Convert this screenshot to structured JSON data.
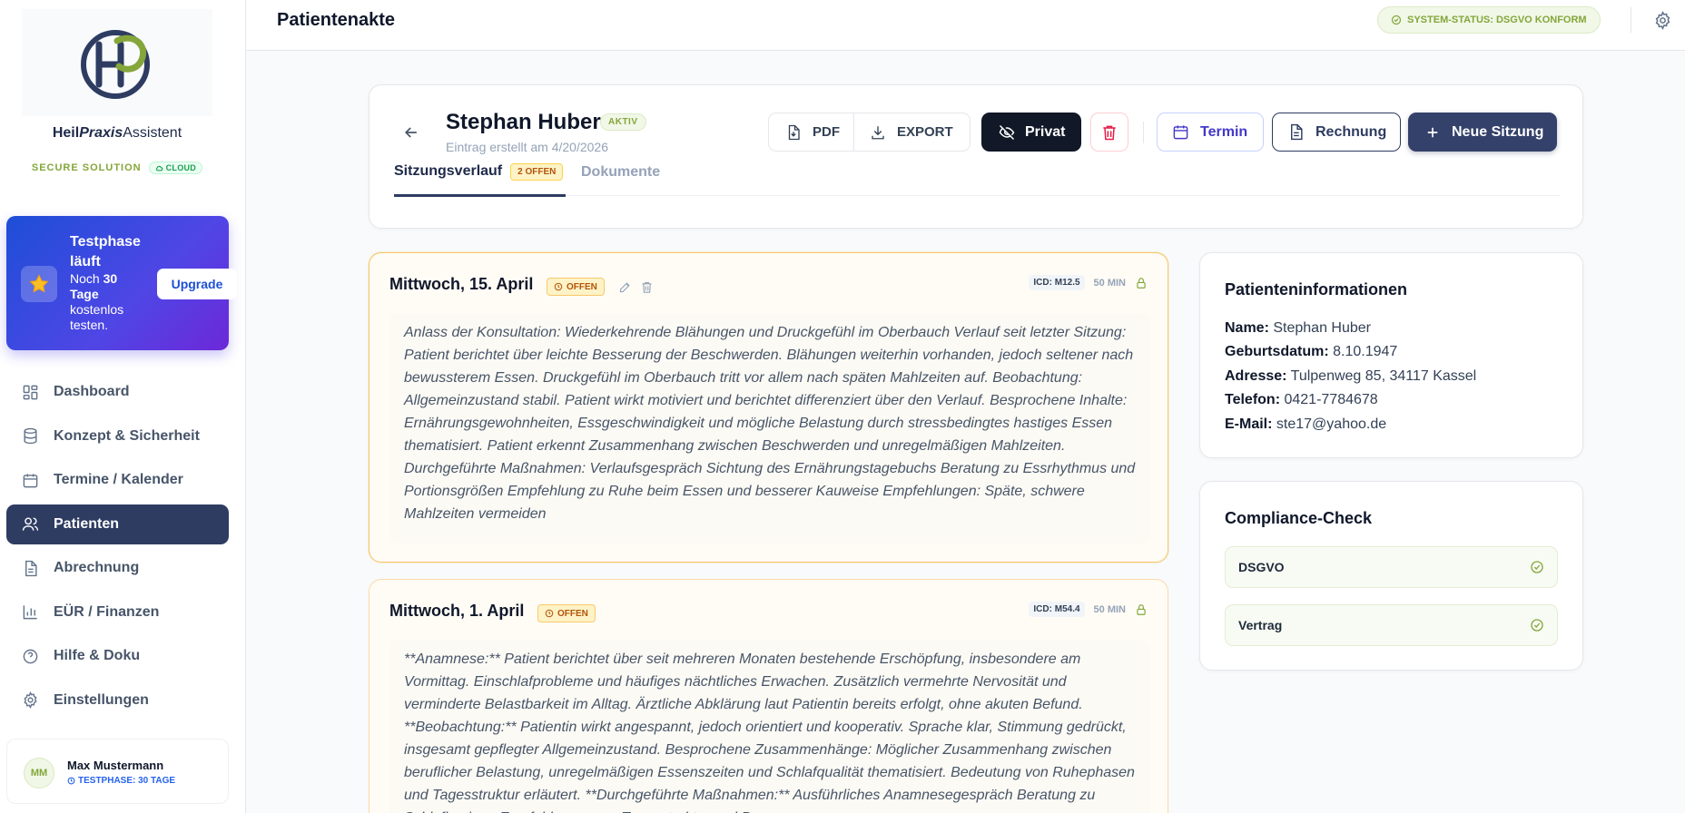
{
  "app": {
    "brand_prefix": "Heil",
    "brand_italic": "Praxis",
    "brand_suffix": "Assistent",
    "tagline": "SECURE SOLUTION",
    "cloud_badge": "CLOUD"
  },
  "trial": {
    "title": "Testphase läuft",
    "text_prefix": "Noch ",
    "days": "30 Tage",
    "text_suffix": " kostenlos testen.",
    "upgrade_label": "Upgrade"
  },
  "nav": [
    {
      "label": "Dashboard",
      "icon": "dashboard-icon"
    },
    {
      "label": "Konzept & Sicherheit",
      "icon": "database-icon"
    },
    {
      "label": "Termine / Kalender",
      "icon": "calendar-icon"
    },
    {
      "label": "Patienten",
      "icon": "users-icon",
      "active": true
    },
    {
      "label": "Abrechnung",
      "icon": "document-icon"
    },
    {
      "label": "EÜR / Finanzen",
      "icon": "bar-chart-icon"
    },
    {
      "label": "Hilfe & Doku",
      "icon": "help-circle-icon"
    },
    {
      "label": "Einstellungen",
      "icon": "gear-icon"
    }
  ],
  "user": {
    "initials": "MM",
    "name": "Max Mustermann",
    "badge": "TESTPHASE: 30 TAGE"
  },
  "header": {
    "title": "Patientenakte",
    "status": "SYSTEM-STATUS: DSGVO KONFORM"
  },
  "patient": {
    "name": "Stephan Huber",
    "status": "AKTIV",
    "created": "Eintrag erstellt am 4/20/2026"
  },
  "actions": {
    "pdf": "PDF",
    "export": "EXPORT",
    "privat": "Privat",
    "termin": "Termin",
    "rechnung": "Rechnung",
    "neue_sitzung": "Neue Sitzung"
  },
  "tabs": {
    "sessions": "Sitzungsverlauf",
    "sessions_badge": "2 OFFEN",
    "documents": "Dokumente"
  },
  "sessions": [
    {
      "date": "Mittwoch, 15. April",
      "status": "OFFEN",
      "icd": "ICD: M12.5",
      "duration": "50 MIN",
      "text": "Anlass der Konsultation: Wiederkehrende Blähungen und Druckgefühl im Oberbauch Verlauf seit letzter Sitzung: Patient berichtet über leichte Besserung der Beschwerden. Blähungen weiterhin vorhanden, jedoch seltener nach bewussterem Essen. Druckgefühl im Oberbauch tritt vor allem nach späten Mahlzeiten auf. Beobachtung: Allgemeinzustand stabil. Patient wirkt motiviert und berichtet differenziert über den Verlauf. Besprochene Inhalte: Ernährungsgewohnheiten, Essgeschwindigkeit und mögliche Belastung durch stressbedingtes hastiges Essen thematisiert. Patient erkennt Zusammenhang zwischen Beschwerden und unregelmäßigen Mahlzeiten. Durchgeführte Maßnahmen: Verlaufsgespräch Sichtung des Ernährungstagebuchs Beratung zu Essrhythmus und Portionsgrößen Empfehlung zu Ruhe beim Essen und besserer Kauweise Empfehlungen: Späte, schwere Mahlzeiten vermeiden"
    },
    {
      "date": "Mittwoch, 1. April",
      "status": "OFFEN",
      "icd": "ICD: M54.4",
      "duration": "50 MIN",
      "text": "**Anamnese:** Patient berichtet über seit mehreren Monaten bestehende Erschöpfung, insbesondere am Vormittag. Einschlafprobleme und häufiges nächtliches Erwachen. Zusätzlich vermehrte Nervosität und verminderte Belastbarkeit im Alltag. Ärztliche Abklärung laut Patientin bereits erfolgt, ohne akuten Befund. **Beobachtung:** Patientin wirkt angespannt, jedoch orientiert und kooperativ. Sprache klar, Stimmung gedrückt, insgesamt gepflegter Allgemeinzustand. Besprochene Zusammenhänge: Möglicher Zusammenhang zwischen beruflicher Belastung, unregelmäßigen Essenszeiten und Schlafqualität thematisiert. Bedeutung von Ruhephasen und Tagesstruktur erläutert. **Durchgeführte Maßnahmen:** Ausführliches Anamnesegespräch Beratung zu Schlafhygiene Empfehlungen zur Tagesstruktur und Pausen"
    }
  ],
  "patient_info": {
    "title": "Patienteninformationen",
    "fields": [
      {
        "label": "Name:",
        "value": "Stephan Huber"
      },
      {
        "label": "Geburtsdatum:",
        "value": "8.10.1947"
      },
      {
        "label": "Adresse:",
        "value": "Tulpenweg 85, 34117 Kassel"
      },
      {
        "label": "Telefon:",
        "value": "0421-7784678"
      },
      {
        "label": "E-Mail:",
        "value": "ste17@yahoo.de"
      }
    ]
  },
  "compliance": {
    "title": "Compliance-Check",
    "items": [
      {
        "label": "DSGVO",
        "ok": true
      },
      {
        "label": "Vertrag",
        "ok": true
      }
    ]
  },
  "colors": {
    "primary": "#2e3c62",
    "accent_green": "#84a63a",
    "warning": "#b45309",
    "danger": "#e11d48",
    "indigo": "#4338ca"
  }
}
